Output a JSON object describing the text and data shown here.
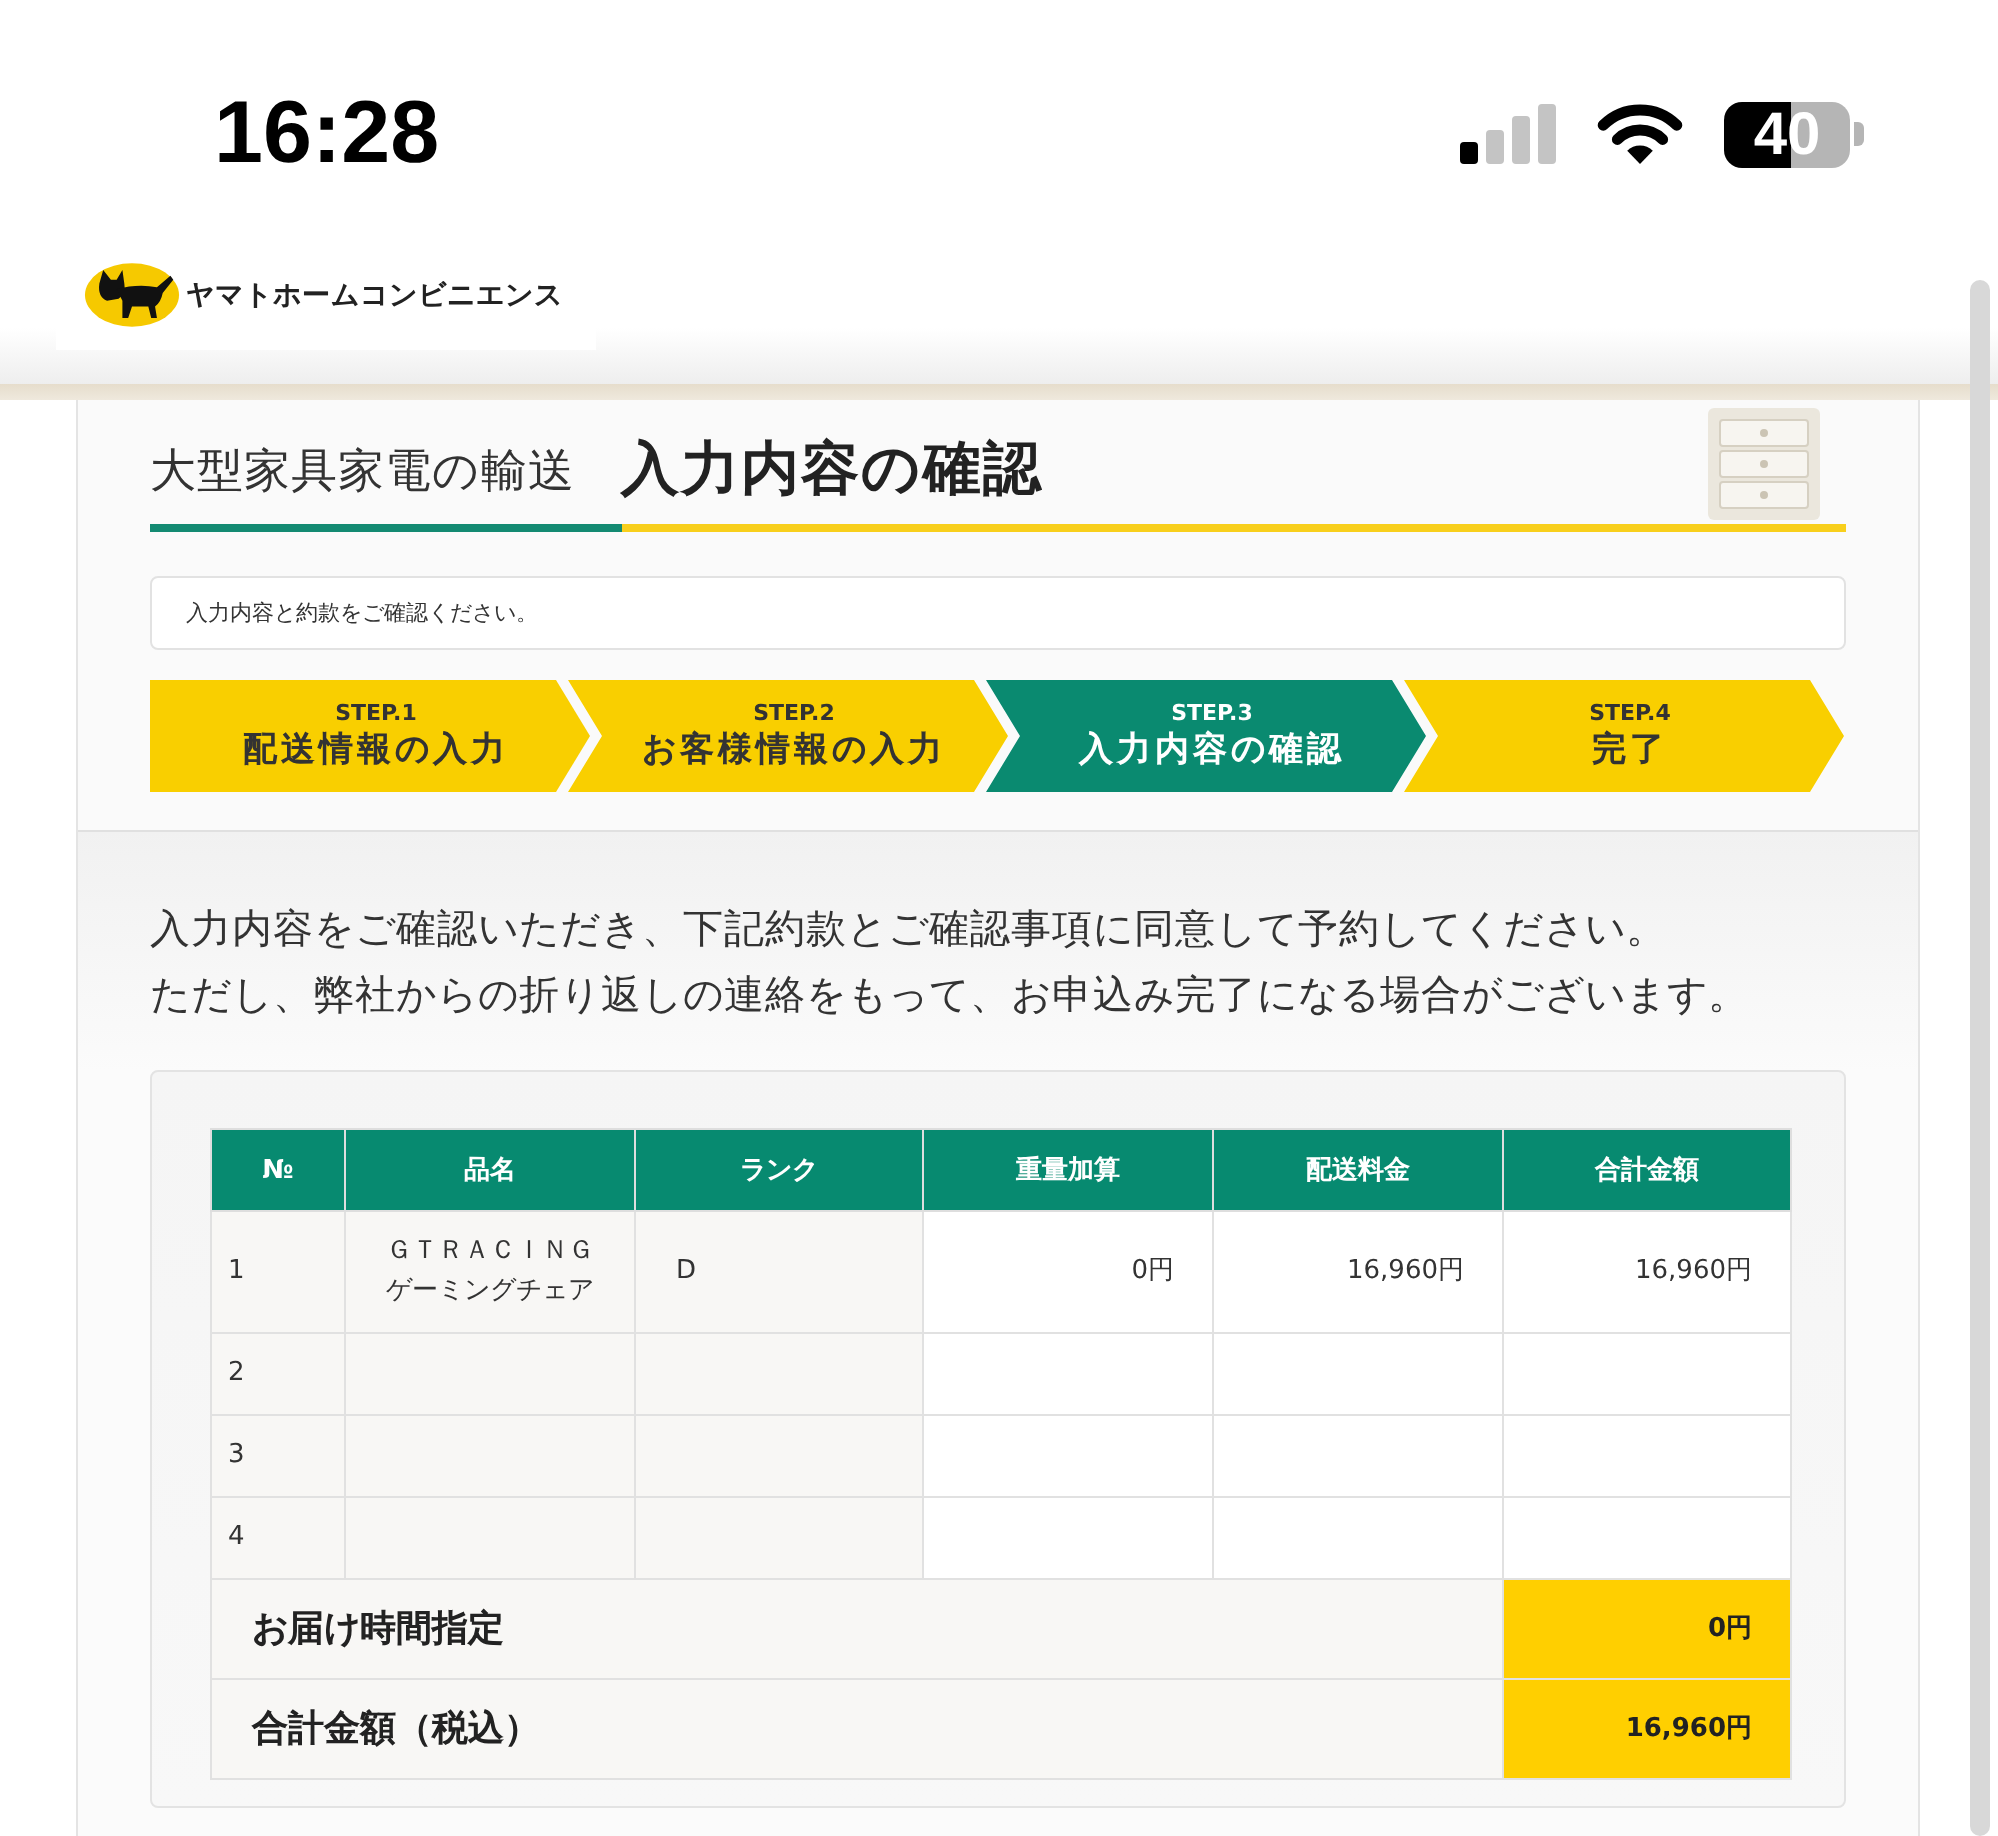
{
  "status_bar": {
    "time": "16:28",
    "battery": "40"
  },
  "header": {
    "logo_text": "ヤマトホームコンビニエンス"
  },
  "page_title": {
    "category": "大型家具家電の輸送",
    "title": "入力内容の確認"
  },
  "notice": "入力内容と約款をご確認ください。",
  "steps": [
    {
      "number": "STEP.1",
      "label": "配送情報の入力",
      "selected": false
    },
    {
      "number": "STEP.2",
      "label": "お客様情報の入力",
      "selected": false
    },
    {
      "number": "STEP.3",
      "label": "入力内容の確認",
      "selected": true
    },
    {
      "number": "STEP.4",
      "label": "完了",
      "selected": false
    }
  ],
  "intro": [
    "入力内容をご確認いただき、下記約款とご確認事項に同意して予約してください。",
    "ただし、弊社からの折り返しの連絡をもって、お申込み完了になる場合がございます。"
  ],
  "table": {
    "columns": [
      "№",
      "品名",
      "ランク",
      "重量加算",
      "配送料金",
      "合計金額"
    ],
    "rows": [
      {
        "no": "1",
        "item_name": [
          "ＧＴＲＡＣＩＮＧ",
          "ゲーミングチェア"
        ],
        "rank": "D",
        "weight_surcharge": "0円",
        "shipping_fee": "16,960円",
        "total": "16,960円"
      },
      {
        "no": "2"
      },
      {
        "no": "3"
      },
      {
        "no": "4"
      }
    ],
    "summary": [
      {
        "label": "お届け時間指定",
        "value": "0円"
      },
      {
        "label": "合計金額（税込）",
        "value": "16,960円"
      }
    ]
  }
}
